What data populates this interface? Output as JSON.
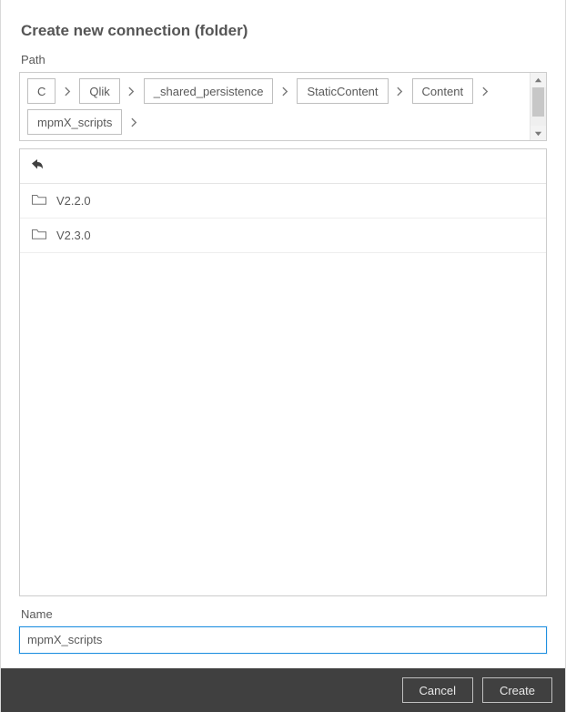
{
  "dialog": {
    "title": "Create new connection (folder)",
    "pathLabel": "Path",
    "nameLabel": "Name",
    "nameValue": "mpmX_scripts"
  },
  "path": {
    "crumbs": [
      "C",
      "Qlik",
      "_shared_persistence",
      "StaticContent",
      "Content",
      "mpmX_scripts"
    ]
  },
  "folders": {
    "items": [
      {
        "label": "V2.2.0"
      },
      {
        "label": "V2.3.0"
      }
    ]
  },
  "footer": {
    "cancel": "Cancel",
    "create": "Create"
  }
}
